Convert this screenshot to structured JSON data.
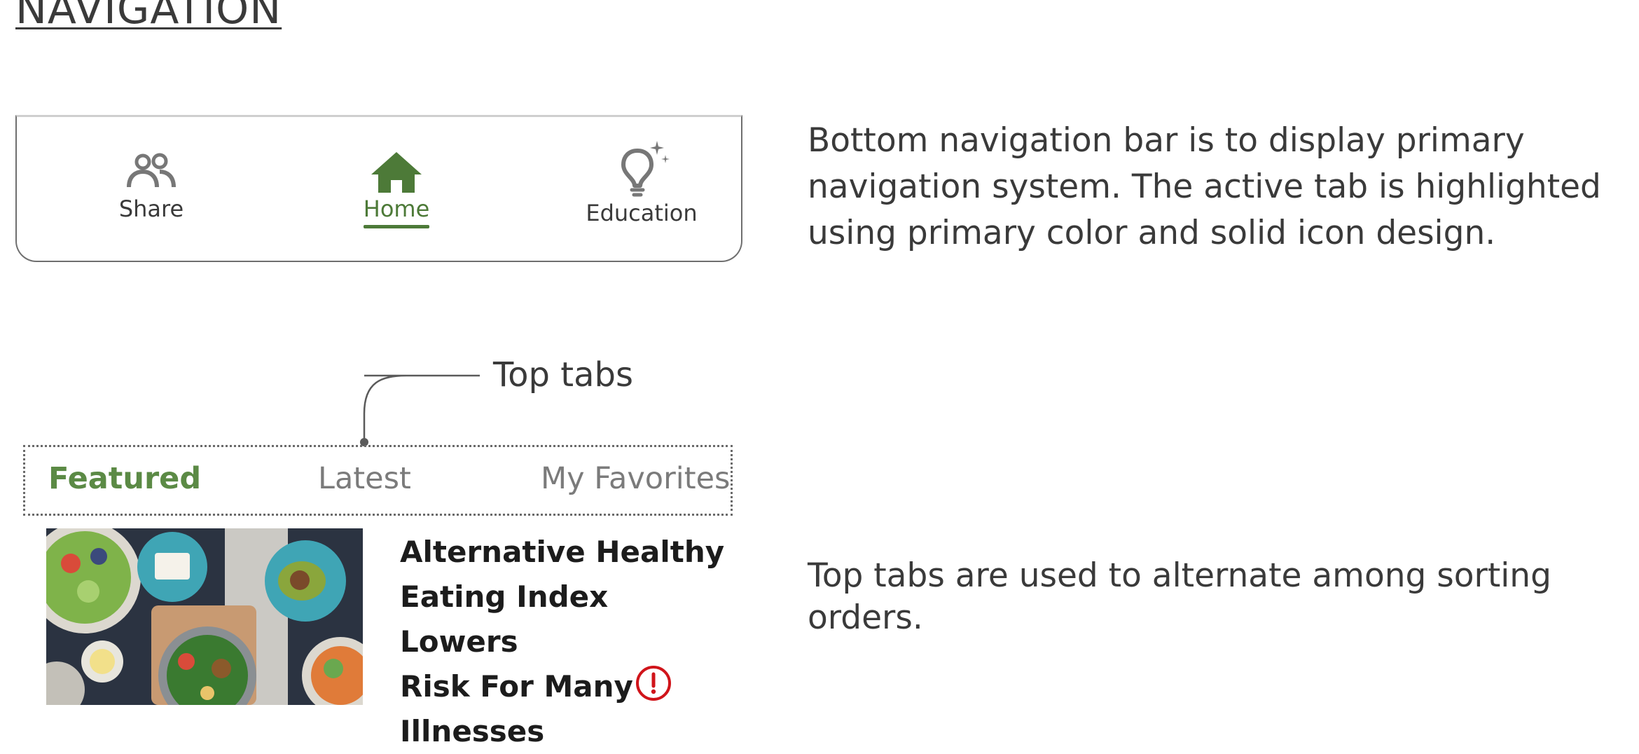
{
  "heading": "NAVIGATION",
  "bottom_nav": {
    "tabs": [
      {
        "label": "Share",
        "icon": "people-icon",
        "active": false
      },
      {
        "label": "Home",
        "icon": "home-icon",
        "active": true
      },
      {
        "label": "Education",
        "icon": "lightbulb-icon",
        "active": false
      }
    ],
    "description": "Bottom navigation bar is to display primary navigation system. The active tab is highlighted using primary color and solid icon design."
  },
  "top_tabs": {
    "callout_label": "Top tabs",
    "tabs": [
      {
        "label": "Featured",
        "active": true
      },
      {
        "label": "Latest",
        "active": false
      },
      {
        "label": "My Favorites",
        "active": false
      }
    ],
    "article": {
      "title": "Alternative Healthy Eating Index Lowers Risk For Many Illnesses",
      "title_lines": [
        "Alternative Healthy",
        "Eating Index Lowers",
        "Risk For Many",
        "Illnesses"
      ],
      "alert_icon": "exclamation-circle-icon"
    },
    "description": "Top tabs are used to alternate among sorting orders."
  },
  "colors": {
    "primary": "#4d7a38",
    "active_top_tab": "#5b8a45",
    "inactive": "#7b7b7b",
    "alert": "#d0141a",
    "text": "#3a3a3a"
  }
}
